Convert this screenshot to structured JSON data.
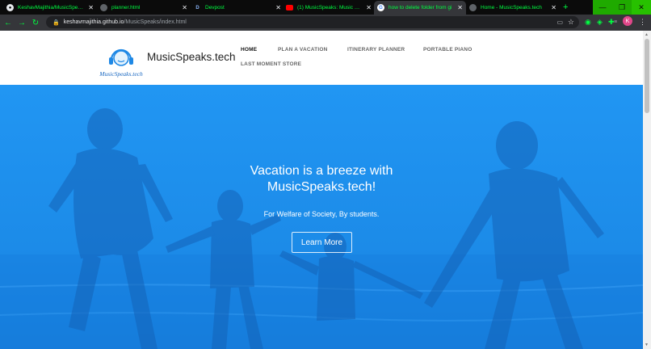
{
  "browser": {
    "tabs": [
      {
        "title": "KeshavMajithia/MusicSpeaks",
        "icon": "github-icon",
        "active": false
      },
      {
        "title": "planner.html",
        "icon": "globe-icon",
        "active": false
      },
      {
        "title": "Devpost",
        "icon": "devpost-icon",
        "active": false
      },
      {
        "title": "(1) MusicSpeaks: Music Spea",
        "icon": "youtube-icon",
        "active": false
      },
      {
        "title": "how to delete folder from gi",
        "icon": "google-icon",
        "active": true
      },
      {
        "title": "Home - MusicSpeaks.tech",
        "icon": "globe-icon",
        "active": false
      }
    ],
    "new_tab": "+",
    "url_host": "keshavmajithia.github.io",
    "url_path": "/MusicSpeaks/index.html",
    "profile_initial": "K",
    "accent": "#00ff41"
  },
  "site": {
    "logo_text": "MusicSpeaks.tech",
    "brand": "MusicSpeaks.tech",
    "nav": [
      {
        "label": "HOME",
        "active": true
      },
      {
        "label": "PLAN A VACATION",
        "active": false
      },
      {
        "label": "ITINERARY PLANNER",
        "active": false
      },
      {
        "label": "PORTABLE PIANO",
        "active": false
      },
      {
        "label": "LAST MOMENT STORE",
        "active": false
      }
    ],
    "hero": {
      "title_line1": "Vacation is a breeze with",
      "title_line2": "MusicSpeaks.tech!",
      "subtitle": "For Welfare of Society, By students.",
      "cta": "Learn More",
      "color": "#1e8ff0"
    }
  }
}
